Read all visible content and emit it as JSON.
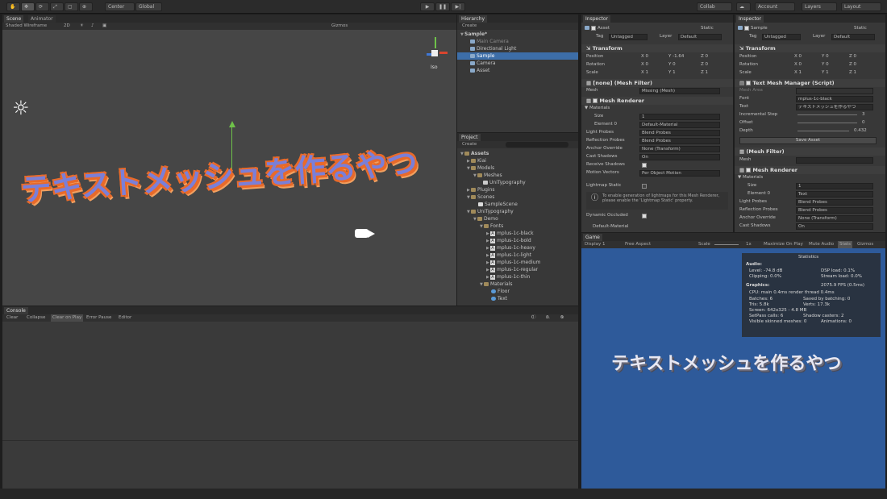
{
  "toolbar": {
    "center": "Center",
    "global": "Global",
    "collab": "Collab",
    "account": "Account",
    "layers": "Layers",
    "layout": "Layout"
  },
  "scene": {
    "tab_scene": "Scene",
    "tab_animator": "Animator",
    "shading": "Shaded Wireframe",
    "mode_2d": "2D",
    "gizmos": "Gizmos",
    "gizmo_label": "Iso",
    "text": "テキストメッシュを作るやつ"
  },
  "hierarchy": {
    "tab": "Hierarchy",
    "create": "Create",
    "items": [
      "Sample*",
      "Main Camera",
      "Directional Light",
      "Sample",
      "Camera",
      "Asset"
    ]
  },
  "project": {
    "tab": "Project",
    "create": "Create",
    "items": [
      "Assets",
      "Kiai",
      "Models",
      "Meshes",
      "UniTypography",
      "Plugins",
      "Scenes",
      "SampleScene",
      "UniTypography",
      "Demo",
      "Fonts",
      "mplus-1c-black",
      "mplus-1c-bold",
      "mplus-1c-heavy",
      "mplus-1c-light",
      "mplus-1c-medium",
      "mplus-1c-regular",
      "mplus-1c-thin",
      "Materials",
      "Floor",
      "Text"
    ]
  },
  "console": {
    "tab": "Console",
    "clear": "Clear",
    "collapse": "Collapse",
    "clear_on_play": "Clear on Play",
    "error_pause": "Error Pause",
    "editor": "Editor",
    "counts": [
      "0",
      "0",
      "0"
    ]
  },
  "inspector1": {
    "tab": "Inspector",
    "name": "Asset",
    "static": "Static",
    "tag_label": "Tag",
    "tag": "Untagged",
    "layer_label": "Layer",
    "layer": "Default",
    "transform": "Transform",
    "position": "Position",
    "rotation": "Rotation",
    "scale": "Scale",
    "pos": [
      "0",
      "-1.64",
      "0"
    ],
    "rot": [
      "0",
      "0",
      "0"
    ],
    "scl": [
      "1",
      "1",
      "1"
    ],
    "mesh_filter": "[none] (Mesh Filter)",
    "mesh_label": "Mesh",
    "mesh_value": "Missing (Mesh)",
    "mesh_renderer": "Mesh Renderer",
    "materials": "Materials",
    "size_label": "Size",
    "size": "1",
    "element0_label": "Element 0",
    "element0": "Default-Material",
    "light_probes_label": "Light Probes",
    "light_probes": "Blend Probes",
    "reflection_label": "Reflection Probes",
    "reflection": "Blend Probes",
    "anchor_label": "Anchor Override",
    "anchor": "None (Transform)",
    "cast_label": "Cast Shadows",
    "cast": "On",
    "receive_label": "Receive Shadows",
    "motion_label": "Motion Vectors",
    "motion": "Per Object Motion",
    "lightmap_label": "Lightmap Static",
    "info": "To enable generation of lightmaps for this Mesh Renderer, please enable the 'Lightmap Static' property.",
    "dynamic_label": "Dynamic Occluded",
    "default_material": "Default-Material"
  },
  "inspector2": {
    "tab": "Inspector",
    "name": "Sample",
    "static": "Static",
    "tag_label": "Tag",
    "tag": "Untagged",
    "layer_label": "Layer",
    "layer": "Default",
    "transform": "Transform",
    "position": "Position",
    "rotation": "Rotation",
    "scale": "Scale",
    "pos": [
      "0",
      "0",
      "0"
    ],
    "rot": [
      "0",
      "0",
      "0"
    ],
    "scl": [
      "1",
      "1",
      "1"
    ],
    "tmm": "Text Mesh Manager (Script)",
    "script_label": "Mesh Area",
    "font_label": "Font",
    "font": "mplus-1c-black",
    "text_label": "Text",
    "text": "テキストメッシュを作るやつ",
    "incstep_label": "Incremental Step",
    "incstep": "3",
    "offset_label": "Offset",
    "offset": "0",
    "depth_label": "Depth",
    "depth": "0.432",
    "save": "Save Asset",
    "mesh_filter": "(Mesh Filter)",
    "mesh_label": "Mesh",
    "mesh_renderer": "Mesh Renderer",
    "materials": "Materials",
    "size_label": "Size",
    "size": "1",
    "element0_label": "Element 0",
    "element0": "Text",
    "light_probes_label": "Light Probes",
    "light_probes": "Blend Probes",
    "reflection_label": "Reflection Probes",
    "reflection": "Blend Probes",
    "anchor_label": "Anchor Override",
    "anchor": "None (Transform)",
    "cast_label": "Cast Shadows",
    "cast": "On"
  },
  "game": {
    "tab": "Game",
    "display": "Display 1",
    "aspect": "Free Aspect",
    "scale_label": "Scale",
    "scale": "1x",
    "maximize": "Maximize On Play",
    "mute": "Mute Audio",
    "stats": "Stats",
    "gizmos": "Gizmos",
    "text": "テキストメッシュを作るやつ",
    "statistics": {
      "title": "Statistics",
      "audio": "Audio:",
      "level": "Level: -74.8 dB",
      "dsp": "DSP load: 0.1%",
      "clipping": "Clipping: 0.0%",
      "stream": "Stream load: 0.0%",
      "graphics": "Graphics:",
      "fps": "2075.9 FPS (0.5ms)",
      "cpu": "CPU: main 0.4ms  render thread 0.4ms",
      "batches": "Batches: 6",
      "saved": "Saved by batching: 0",
      "tris": "Tris: 5.8k",
      "verts": "Verts: 17.3k",
      "screen": "Screen: 642x325 - 4.8 MB",
      "setpass": "SetPass calls: 6",
      "shadow": "Shadow casters: 2",
      "skinned": "Visible skinned meshes: 0",
      "animations": "Animations: 0"
    }
  }
}
